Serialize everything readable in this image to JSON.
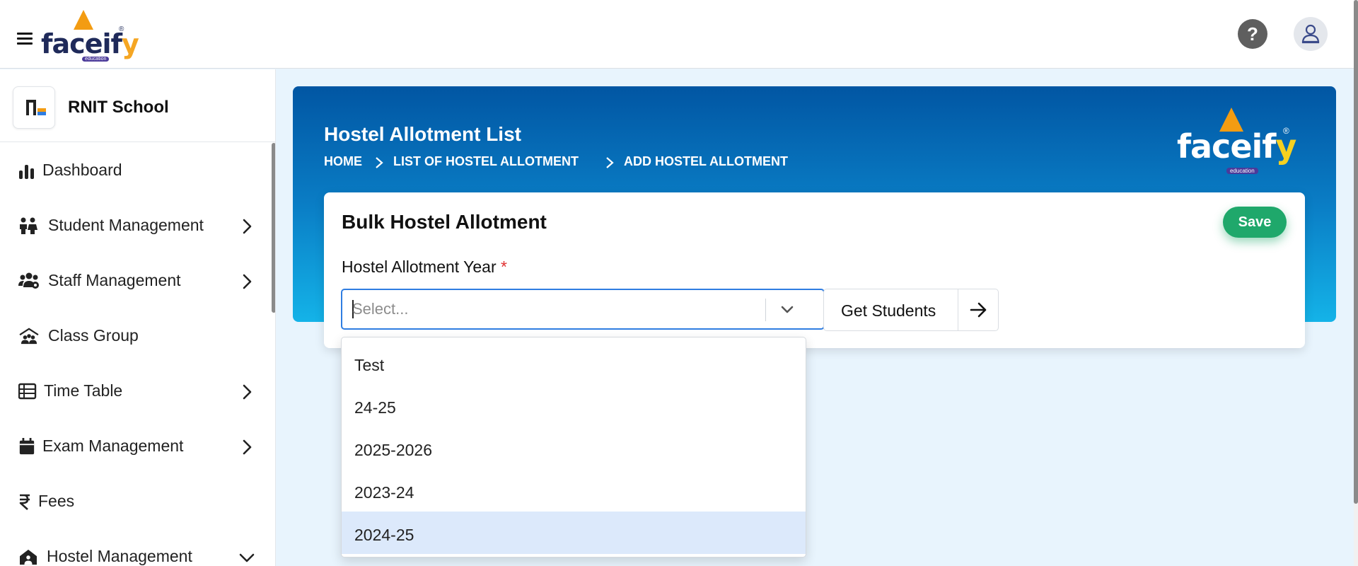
{
  "header": {
    "logo_text": "faceify",
    "logo_subtext": "education",
    "help_label": "?"
  },
  "sidebar": {
    "school_name": "RNIT School",
    "items": [
      {
        "label": "Dashboard",
        "icon": "chart-bars-icon",
        "has_submenu": false
      },
      {
        "label": "Student Management",
        "icon": "students-icon",
        "has_submenu": true
      },
      {
        "label": "Staff Management",
        "icon": "staff-icon",
        "has_submenu": true
      },
      {
        "label": "Class Group",
        "icon": "class-group-icon",
        "has_submenu": false
      },
      {
        "label": "Time Table",
        "icon": "table-list-icon",
        "has_submenu": true
      },
      {
        "label": "Exam Management",
        "icon": "calendar-icon",
        "has_submenu": true
      },
      {
        "label": "Fees",
        "icon": "rupee-icon",
        "has_submenu": false
      },
      {
        "label": "Hostel Management",
        "icon": "hostel-icon",
        "has_submenu": true,
        "expanded": true
      }
    ]
  },
  "banner": {
    "title": "Hostel Allotment List",
    "breadcrumb": [
      "HOME",
      "LIST OF HOSTEL ALLOTMENT",
      "ADD HOSTEL ALLOTMENT"
    ]
  },
  "card": {
    "title": "Bulk Hostel Allotment",
    "save_label": "Save",
    "field_label": "Hostel Allotment Year",
    "required_mark": "*",
    "select_placeholder": "Select...",
    "select_value": "",
    "get_students_label": "Get Students"
  },
  "dropdown": {
    "options": [
      "Test",
      "24-25",
      "2025-2026",
      "2023-24",
      "2024-25"
    ],
    "highlighted_index": 4
  },
  "colors": {
    "accent_blue": "#2f7de1",
    "save_green": "#1fa86b",
    "banner_top": "#0156a3",
    "banner_bottom": "#14b3e8",
    "highlight": "#dce9fb",
    "page_bg": "#e8f4fd"
  }
}
